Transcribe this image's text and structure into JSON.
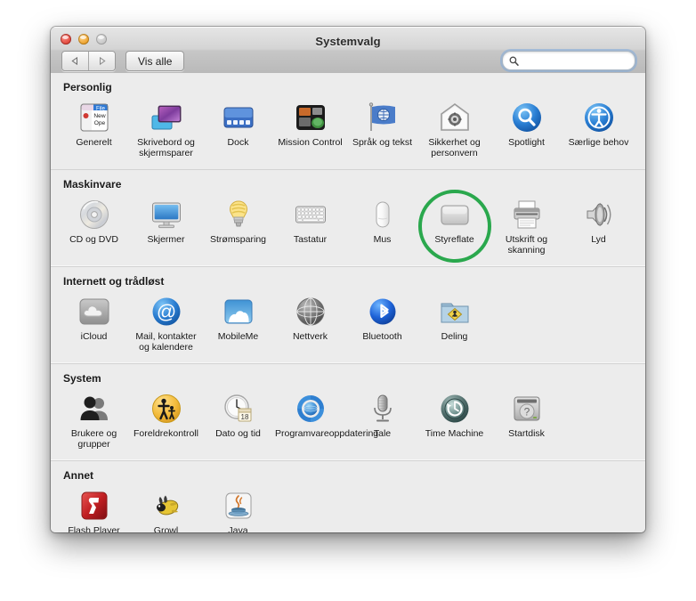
{
  "window": {
    "title": "Systemvalg",
    "traffic_lights": [
      "close",
      "minimize",
      "zoom"
    ]
  },
  "toolbar": {
    "back_label": "Tilbake",
    "forward_label": "Fram",
    "show_all_label": "Vis alle",
    "search": {
      "value": "",
      "placeholder": ""
    }
  },
  "highlight": {
    "target": "Styreflate",
    "color": "#2aa84d"
  },
  "sections": [
    {
      "title": "Personlig",
      "items": [
        {
          "label": "Generelt",
          "icon": "general-icon"
        },
        {
          "label": "Skrivebord og skjermsparer",
          "icon": "desktop-screensaver-icon"
        },
        {
          "label": "Dock",
          "icon": "dock-icon"
        },
        {
          "label": "Mission Control",
          "icon": "mission-control-icon"
        },
        {
          "label": "Språk og tekst",
          "icon": "language-text-icon"
        },
        {
          "label": "Sikkerhet og personvern",
          "icon": "security-privacy-icon"
        },
        {
          "label": "Spotlight",
          "icon": "spotlight-icon"
        },
        {
          "label": "Særlige behov",
          "icon": "accessibility-icon"
        }
      ]
    },
    {
      "title": "Maskinvare",
      "items": [
        {
          "label": "CD og DVD",
          "icon": "cd-dvd-icon"
        },
        {
          "label": "Skjermer",
          "icon": "displays-icon"
        },
        {
          "label": "Strømsparing",
          "icon": "energy-saver-icon"
        },
        {
          "label": "Tastatur",
          "icon": "keyboard-icon"
        },
        {
          "label": "Mus",
          "icon": "mouse-icon"
        },
        {
          "label": "Styreflate",
          "icon": "trackpad-icon",
          "highlighted": true
        },
        {
          "label": "Utskrift og skanning",
          "icon": "print-scan-icon"
        },
        {
          "label": "Lyd",
          "icon": "sound-icon"
        }
      ]
    },
    {
      "title": "Internett og trådløst",
      "items": [
        {
          "label": "iCloud",
          "icon": "icloud-icon"
        },
        {
          "label": "Mail, kontakter og kalendere",
          "icon": "mail-contacts-calendars-icon"
        },
        {
          "label": "MobileMe",
          "icon": "mobileme-icon"
        },
        {
          "label": "Nettverk",
          "icon": "network-icon"
        },
        {
          "label": "Bluetooth",
          "icon": "bluetooth-icon"
        },
        {
          "label": "Deling",
          "icon": "sharing-icon"
        }
      ]
    },
    {
      "title": "System",
      "items": [
        {
          "label": "Brukere og grupper",
          "icon": "users-groups-icon"
        },
        {
          "label": "Foreldrekontroll",
          "icon": "parental-controls-icon"
        },
        {
          "label": "Dato og tid",
          "icon": "date-time-icon"
        },
        {
          "label": "Programvareoppdatering",
          "icon": "software-update-icon"
        },
        {
          "label": "Tale",
          "icon": "speech-icon"
        },
        {
          "label": "Time Machine",
          "icon": "time-machine-icon"
        },
        {
          "label": "Startdisk",
          "icon": "startup-disk-icon"
        }
      ]
    },
    {
      "title": "Annet",
      "items": [
        {
          "label": "Flash Player",
          "icon": "flash-player-icon"
        },
        {
          "label": "Growl",
          "icon": "growl-icon"
        },
        {
          "label": "Java",
          "icon": "java-icon"
        }
      ]
    }
  ]
}
